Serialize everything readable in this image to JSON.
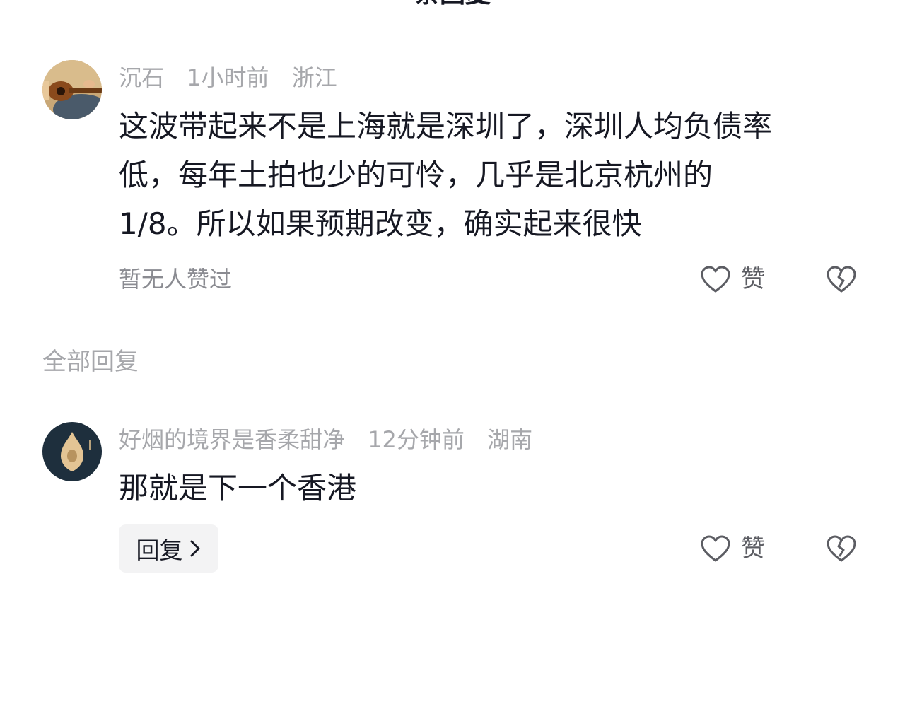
{
  "header": {
    "title": "条回复"
  },
  "main_comment": {
    "username": "沉石",
    "time": "1小时前",
    "location": "浙江",
    "text_lines": [
      "这波带起来不是上海就是深圳了，深圳人均负债率",
      "低，每年土拍也少的可怜，几乎是北京杭州的",
      "1/8。所以如果预期改变，确实起来很快"
    ],
    "like_status": "暂无人赞过",
    "like_label": "赞"
  },
  "replies_section": {
    "title": "全部回复"
  },
  "reply": {
    "username": "好烟的境界是香柔甜净",
    "time": "12分钟前",
    "location": "湖南",
    "text": "那就是下一个香港",
    "reply_button_label": "回复",
    "like_label": "赞"
  },
  "icons": {
    "like": "heart-outline-icon",
    "dislike": "broken-heart-icon",
    "reply_chevron": "chevron-right-icon"
  }
}
